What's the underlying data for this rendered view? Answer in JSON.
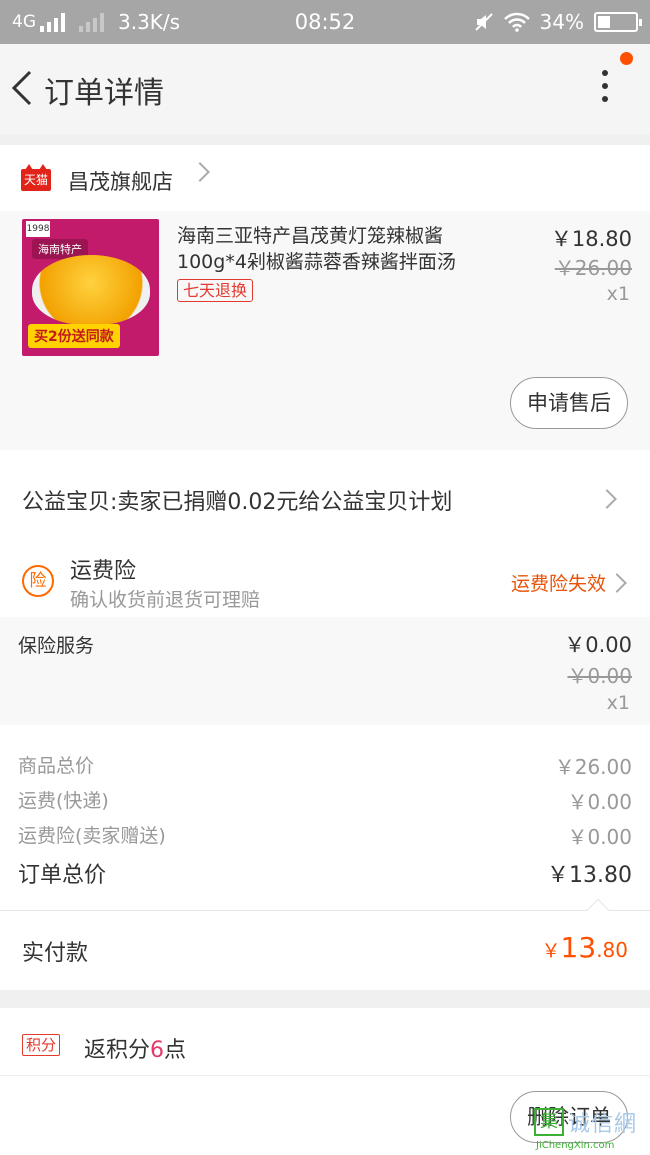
{
  "status_bar": {
    "network": "4G",
    "speed": "3.3K/s",
    "time": "08:52",
    "battery": "34%",
    "battery_level": 0.34
  },
  "header": {
    "title": "订单详情",
    "notification_dot_color": "#ff5000"
  },
  "store": {
    "badge": "天猫",
    "name": "昌茂旗舰店"
  },
  "item": {
    "title": "海南三亚特产昌茂黄灯笼辣椒酱100g*4剁椒酱蒜蓉香辣酱拌面汤",
    "badge": "七天退换",
    "price": "￥18.80",
    "original_price": "￥26.00",
    "quantity": "x1",
    "thumb_tag": "海南特产",
    "thumb_banner": "买2份送同款",
    "thumb_corner": "1998",
    "after_sale_label": "申请售后"
  },
  "charity": {
    "text": "公益宝贝:卖家已捐赠0.02元给公益宝贝计划"
  },
  "shipping_insurance": {
    "icon_char": "险",
    "title": "运费险",
    "subtitle": "确认收货前退货可理赔",
    "status": "运费险失效"
  },
  "service": {
    "name": "保险服务",
    "price": "￥0.00",
    "original_price": "￥0.00",
    "quantity": "x1"
  },
  "totals": {
    "goods_label": "商品总价",
    "goods_value": "￥26.00",
    "shipping_label": "运费(快递)",
    "shipping_value": "￥0.00",
    "insurance_label": "运费险(卖家赠送)",
    "insurance_value": "￥0.00",
    "order_total_label": "订单总价",
    "order_total_value": "￥13.80"
  },
  "paid": {
    "label": "实付款",
    "currency": "￥",
    "integer": "13",
    "decimal": ".80"
  },
  "points": {
    "badge": "积分",
    "prefix": "返积分",
    "count": "6",
    "suffix": "点"
  },
  "actions": {
    "delete_label": "删除订单"
  },
  "watermark": {
    "logo_char": "集",
    "text": "诚信網",
    "url": "JiChengXin.com"
  },
  "colors": {
    "accent": "#ff5000",
    "tmall_red": "#e2231a",
    "insurance_orange": "#e8540a"
  }
}
